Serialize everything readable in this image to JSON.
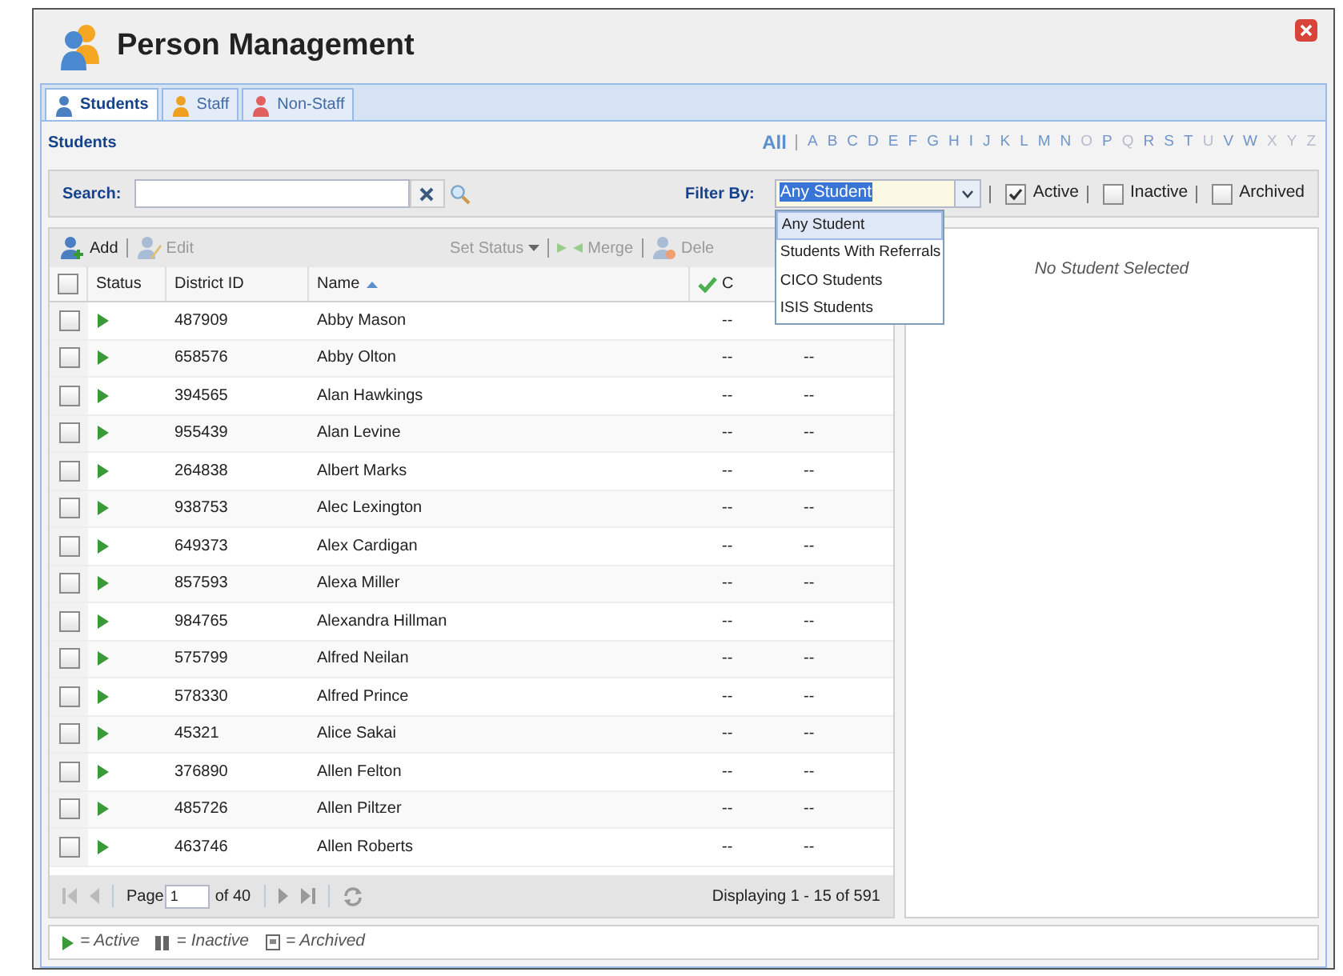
{
  "window": {
    "title": "Person Management"
  },
  "tabs": [
    {
      "label": "Students",
      "selected": true,
      "color": "#4a7fc1"
    },
    {
      "label": "Staff",
      "selected": false,
      "color": "#f0a020"
    },
    {
      "label": "Non-Staff",
      "selected": false,
      "color": "#e06060"
    }
  ],
  "panel": {
    "title": "Students",
    "all_link": {
      "label": "All",
      "selected": true
    },
    "letters": [
      {
        "label": "A",
        "disabled": false
      },
      {
        "label": "B",
        "disabled": false
      },
      {
        "label": "C",
        "disabled": false
      },
      {
        "label": "D",
        "disabled": false
      },
      {
        "label": "E",
        "disabled": false
      },
      {
        "label": "F",
        "disabled": false
      },
      {
        "label": "G",
        "disabled": false
      },
      {
        "label": "H",
        "disabled": false
      },
      {
        "label": "I",
        "disabled": false
      },
      {
        "label": "J",
        "disabled": false
      },
      {
        "label": "K",
        "disabled": false
      },
      {
        "label": "L",
        "disabled": false
      },
      {
        "label": "M",
        "disabled": false
      },
      {
        "label": "N",
        "disabled": false
      },
      {
        "label": "O",
        "disabled": true
      },
      {
        "label": "P",
        "disabled": false
      },
      {
        "label": "Q",
        "disabled": true
      },
      {
        "label": "R",
        "disabled": false
      },
      {
        "label": "S",
        "disabled": false
      },
      {
        "label": "T",
        "disabled": false
      },
      {
        "label": "U",
        "disabled": true
      },
      {
        "label": "V",
        "disabled": false
      },
      {
        "label": "W",
        "disabled": false
      },
      {
        "label": "X",
        "disabled": true
      },
      {
        "label": "Y",
        "disabled": true
      },
      {
        "label": "Z",
        "disabled": true
      }
    ]
  },
  "search": {
    "label": "Search:"
  },
  "filter": {
    "label": "Filter By:",
    "value": "Any Student",
    "options": [
      {
        "label": "Any Student",
        "selected": true
      },
      {
        "label": "Students With Referrals",
        "selected": false
      },
      {
        "label": "CICO Students",
        "selected": false
      },
      {
        "label": "ISIS Students",
        "selected": false
      }
    ],
    "checks": [
      {
        "label": "Active",
        "checked": true
      },
      {
        "label": "Inactive",
        "checked": false
      },
      {
        "label": "Archived",
        "checked": false
      }
    ]
  },
  "toolbar": [
    {
      "label": "Add",
      "disabled": false,
      "kind": "add"
    },
    {
      "label": "Edit",
      "disabled": true,
      "kind": "edit"
    },
    {
      "label": "Set Status",
      "disabled": true,
      "kind": "menu"
    },
    {
      "label": "Merge",
      "disabled": true,
      "kind": "merge"
    },
    {
      "label": "Dele",
      "disabled": true,
      "kind": "delete"
    }
  ],
  "table": {
    "select_all_checked": false,
    "columns": [
      "Status",
      "District ID",
      "Name",
      "C"
    ],
    "rows": [
      {
        "checked": false,
        "kind": "active",
        "district_id": "487909",
        "name": "Abby Mason",
        "column_5": "--"
      },
      {
        "checked": false,
        "kind": "active",
        "district_id": "658576",
        "name": "Abby Olton",
        "column_5": "--",
        "column_6": "--"
      },
      {
        "checked": false,
        "kind": "active",
        "district_id": "394565",
        "name": "Alan Hawkings",
        "column_5": "--",
        "column_6": "--"
      },
      {
        "checked": false,
        "kind": "active",
        "district_id": "955439",
        "name": "Alan Levine",
        "column_5": "--",
        "column_6": "--"
      },
      {
        "checked": false,
        "kind": "active",
        "district_id": "264838",
        "name": "Albert Marks",
        "column_5": "--",
        "column_6": "--"
      },
      {
        "checked": false,
        "kind": "active",
        "district_id": "938753",
        "name": "Alec Lexington",
        "column_5": "--",
        "column_6": "--"
      },
      {
        "checked": false,
        "kind": "active",
        "district_id": "649373",
        "name": "Alex Cardigan",
        "column_5": "--",
        "column_6": "--"
      },
      {
        "checked": false,
        "kind": "active",
        "district_id": "857593",
        "name": "Alexa Miller",
        "column_5": "--",
        "column_6": "--"
      },
      {
        "checked": false,
        "kind": "active",
        "district_id": "984765",
        "name": "Alexandra Hillman",
        "column_5": "--",
        "column_6": "--"
      },
      {
        "checked": false,
        "kind": "active",
        "district_id": "575799",
        "name": "Alfred Neilan",
        "column_5": "--",
        "column_6": "--"
      },
      {
        "checked": false,
        "kind": "active",
        "district_id": "578330",
        "name": "Alfred Prince",
        "column_5": "--",
        "column_6": "--"
      },
      {
        "checked": false,
        "kind": "active",
        "district_id": "45321",
        "name": "Alice Sakai",
        "column_5": "--",
        "column_6": "--"
      },
      {
        "checked": false,
        "kind": "active",
        "district_id": "376890",
        "name": "Allen Felton",
        "column_5": "--",
        "column_6": "--"
      },
      {
        "checked": false,
        "kind": "active",
        "district_id": "485726",
        "name": "Allen Piltzer",
        "column_5": "--",
        "column_6": "--"
      },
      {
        "checked": false,
        "kind": "active",
        "district_id": "463746",
        "name": "Allen Roberts",
        "column_5": "--",
        "column_6": "--"
      }
    ]
  },
  "pager": {
    "page_label": "Page",
    "page": "1",
    "of": "of 40",
    "display": "Displaying 1 - 15 of 591"
  },
  "detail": {
    "empty": "No Student Selected"
  },
  "legend": [
    {
      "kind": "active",
      "label": "= Active"
    },
    {
      "kind": "inactive",
      "label": "= Inactive"
    },
    {
      "kind": "archived",
      "label": "= Archived"
    }
  ]
}
